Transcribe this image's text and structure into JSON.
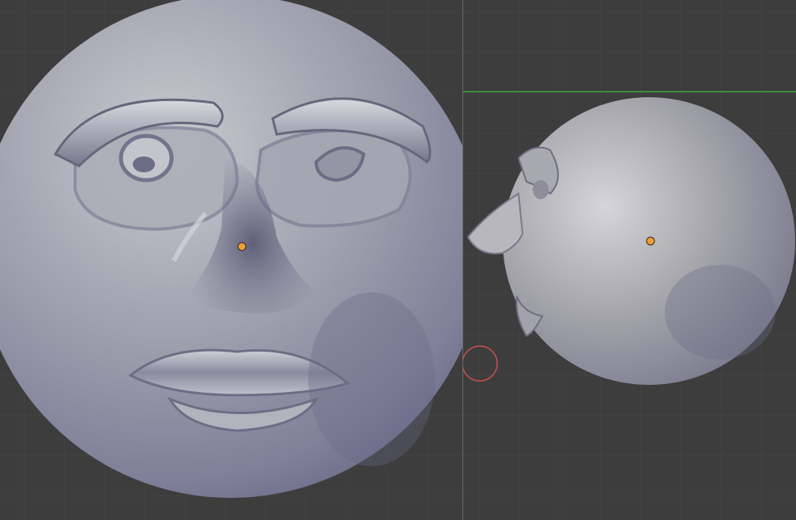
{
  "workspace": {
    "grid_color": "#474747",
    "background_color": "#3d3d3d",
    "divider_color": "#6a6a6a"
  },
  "viewports": [
    {
      "view": "front",
      "object": "sculpted-moon-face-sphere",
      "object_color": "#8f90a6",
      "origin_color": "#f0a030",
      "icons": [
        "origin-dot-icon"
      ]
    },
    {
      "view": "side",
      "object": "sculpted-moon-face-sphere",
      "object_color": "#9a9aa4",
      "origin_color": "#f0a030",
      "y_axis_color": "#3c8c3c",
      "brush_cursor_color": "#c85050",
      "icons": [
        "origin-dot-icon",
        "brush-cursor-icon",
        "y-axis-line"
      ]
    }
  ]
}
